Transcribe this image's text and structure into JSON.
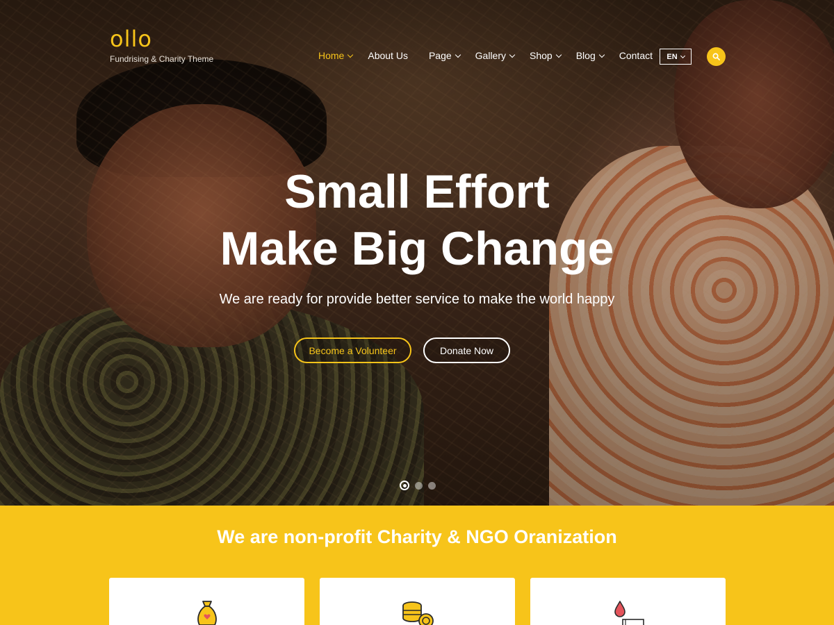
{
  "brand": {
    "name": "ollo",
    "tagline": "Fundrising & Charity Theme",
    "accent_color": "#f7c41a"
  },
  "nav": {
    "items": [
      {
        "label": "Home",
        "has_dropdown": true,
        "active": true
      },
      {
        "label": "About Us",
        "has_dropdown": false,
        "active": false
      },
      {
        "label": "Page",
        "has_dropdown": true,
        "active": false
      },
      {
        "label": "Gallery",
        "has_dropdown": true,
        "active": false
      },
      {
        "label": "Shop",
        "has_dropdown": true,
        "active": false
      },
      {
        "label": "Blog",
        "has_dropdown": true,
        "active": false
      },
      {
        "label": "Contact",
        "has_dropdown": false,
        "active": false
      }
    ],
    "language": "EN",
    "search_icon": "search-icon"
  },
  "hero": {
    "title_line1": "Small Effort",
    "title_line2": "Make Big Change",
    "subtitle": "We are ready for provide better service to make the world happy",
    "primary_button": "Become a Volunteer",
    "secondary_button": "Donate Now",
    "slides_total": 3,
    "active_slide": 1
  },
  "section": {
    "title": "We are non-profit Charity & NGO Oranization",
    "cards": [
      {
        "icon": "money-bag-icon"
      },
      {
        "icon": "coins-icon"
      },
      {
        "icon": "blood-drop-icon"
      }
    ]
  }
}
